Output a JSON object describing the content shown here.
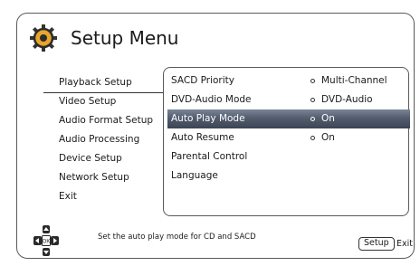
{
  "header": {
    "title": "Setup Menu",
    "icon": "gear-icon"
  },
  "left_menu": {
    "items": [
      {
        "label": "Playback Setup"
      },
      {
        "label": "Video Setup"
      },
      {
        "label": "Audio Format Setup"
      },
      {
        "label": "Audio Processing"
      },
      {
        "label": "Device Setup"
      },
      {
        "label": "Network Setup"
      },
      {
        "label": "Exit"
      }
    ],
    "active": "Playback Setup"
  },
  "submenu": {
    "items": [
      {
        "label": "SACD Priority",
        "value": "Multi-Channel"
      },
      {
        "label": "DVD-Audio Mode",
        "value": "DVD-Audio"
      },
      {
        "label": "Auto Play Mode",
        "value": "On"
      },
      {
        "label": "Auto Resume",
        "value": "On"
      },
      {
        "label": "Parental Control",
        "value": ""
      },
      {
        "label": "Language",
        "value": ""
      }
    ],
    "selected": "Auto Play Mode"
  },
  "footer": {
    "hint": "Set the auto play mode for CD and SACD",
    "setup_button": "Setup",
    "exit_label": "Exit",
    "nav_ok": "OK"
  },
  "colors": {
    "highlight_top": "#7a8598",
    "highlight_bottom": "#3c4454",
    "border": "#5a5a5a"
  }
}
